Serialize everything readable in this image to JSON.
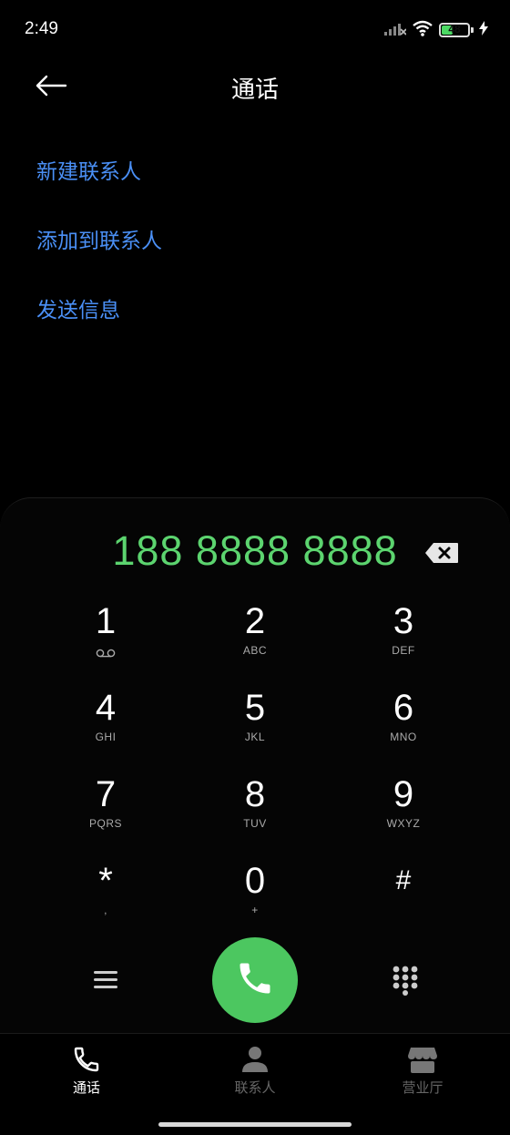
{
  "status_bar": {
    "time": "2:49",
    "battery_level": "48",
    "battery_fraction": 0.48,
    "icons": [
      "signal-off-icon",
      "wifi-icon",
      "battery-icon",
      "charging-icon"
    ]
  },
  "header": {
    "back_icon": "arrow-left-icon",
    "title": "通话"
  },
  "actions": [
    {
      "label": "新建联系人"
    },
    {
      "label": "添加到联系人"
    },
    {
      "label": "发送信息"
    }
  ],
  "dialer": {
    "number": "188 8888 8888",
    "keys": [
      {
        "digit": "1",
        "sub": ""
      },
      {
        "digit": "2",
        "sub": "ABC"
      },
      {
        "digit": "3",
        "sub": "DEF"
      },
      {
        "digit": "4",
        "sub": "GHI"
      },
      {
        "digit": "5",
        "sub": "JKL"
      },
      {
        "digit": "6",
        "sub": "MNO"
      },
      {
        "digit": "7",
        "sub": "PQRS"
      },
      {
        "digit": "8",
        "sub": "TUV"
      },
      {
        "digit": "9",
        "sub": "WXYZ"
      },
      {
        "digit": "*",
        "sub": ","
      },
      {
        "digit": "0",
        "sub": "+"
      },
      {
        "digit": "#",
        "sub": ""
      }
    ]
  },
  "bottom_nav": [
    {
      "label": "通话",
      "icon": "phone-icon",
      "active": true
    },
    {
      "label": "联系人",
      "icon": "person-icon",
      "active": false
    },
    {
      "label": "营业厅",
      "icon": "store-icon",
      "active": false
    }
  ],
  "colors": {
    "accent_blue": "#4a8ff5",
    "number_green": "#5cd46f",
    "call_green": "#4cc760",
    "background": "#000000"
  }
}
